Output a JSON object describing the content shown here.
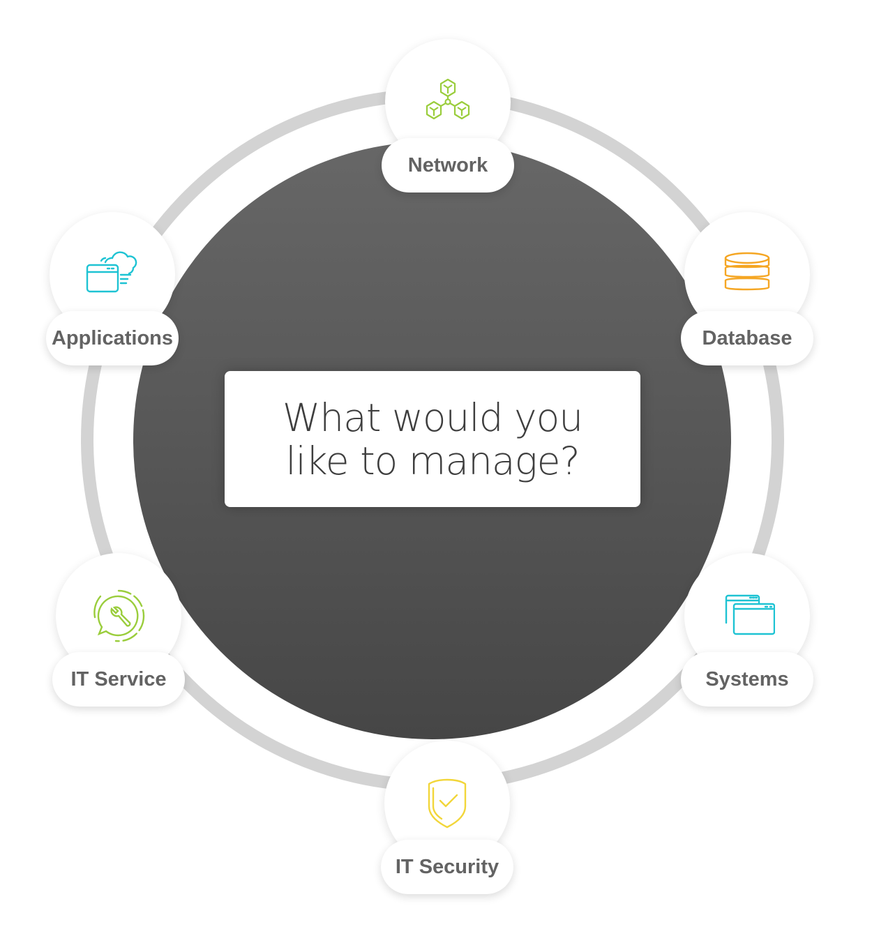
{
  "center": {
    "line1": "What would you",
    "line2": "like to manage?"
  },
  "colors": {
    "lime": "#9acd3c",
    "cyan": "#1ec3d3",
    "orange": "#f5a623",
    "yellow": "#f2d63a",
    "ring": "#d3d3d3",
    "label": "#636363"
  },
  "nodes": [
    {
      "label": "Network",
      "icon": "network-cubes-icon"
    },
    {
      "label": "Database",
      "icon": "database-icon"
    },
    {
      "label": "Systems",
      "icon": "browser-windows-icon"
    },
    {
      "label": "IT Security",
      "icon": "shield-check-icon"
    },
    {
      "label": "IT Service",
      "icon": "wrench-chat-icon"
    },
    {
      "label": "Applications",
      "icon": "cloud-app-icon"
    }
  ]
}
